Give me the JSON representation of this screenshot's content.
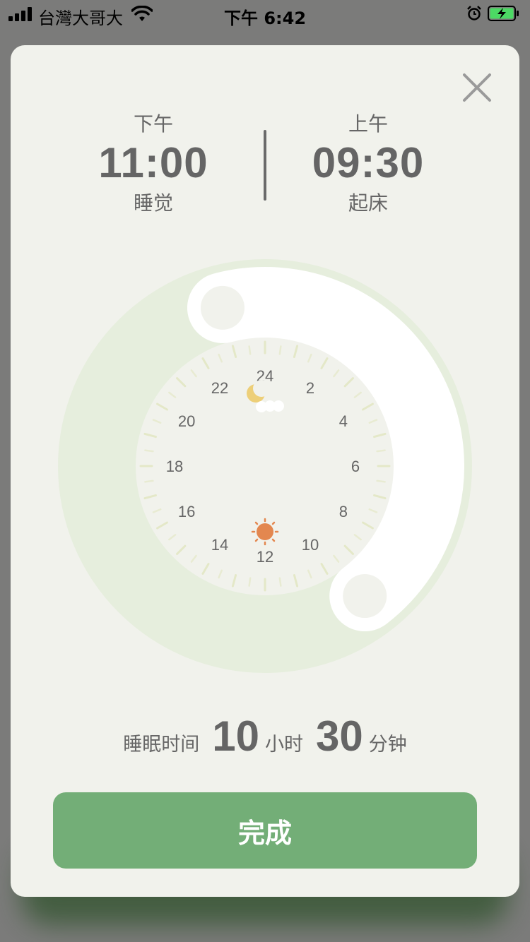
{
  "status_bar": {
    "carrier": "台灣大哥大",
    "time": "下午 6:42"
  },
  "sleep": {
    "ampm": "下午",
    "time": "11:00",
    "label": "睡觉"
  },
  "wake": {
    "ampm": "上午",
    "time": "09:30",
    "label": "起床"
  },
  "dial": {
    "hour_labels": [
      "24",
      "2",
      "4",
      "6",
      "8",
      "10",
      "12",
      "14",
      "16",
      "18",
      "20",
      "22"
    ],
    "icons": [
      "moon-icon",
      "sun-icon"
    ]
  },
  "summary": {
    "prefix": "睡眠时间",
    "hours": "10",
    "hours_unit": "小时",
    "minutes": "30",
    "minutes_unit": "分钟"
  },
  "done_label": "完成",
  "colors": {
    "card_bg": "#f1f2ec",
    "ring": "#e6eedd",
    "button": "#73ae77",
    "sun": "#e3874f",
    "moon": "#edcf78"
  }
}
